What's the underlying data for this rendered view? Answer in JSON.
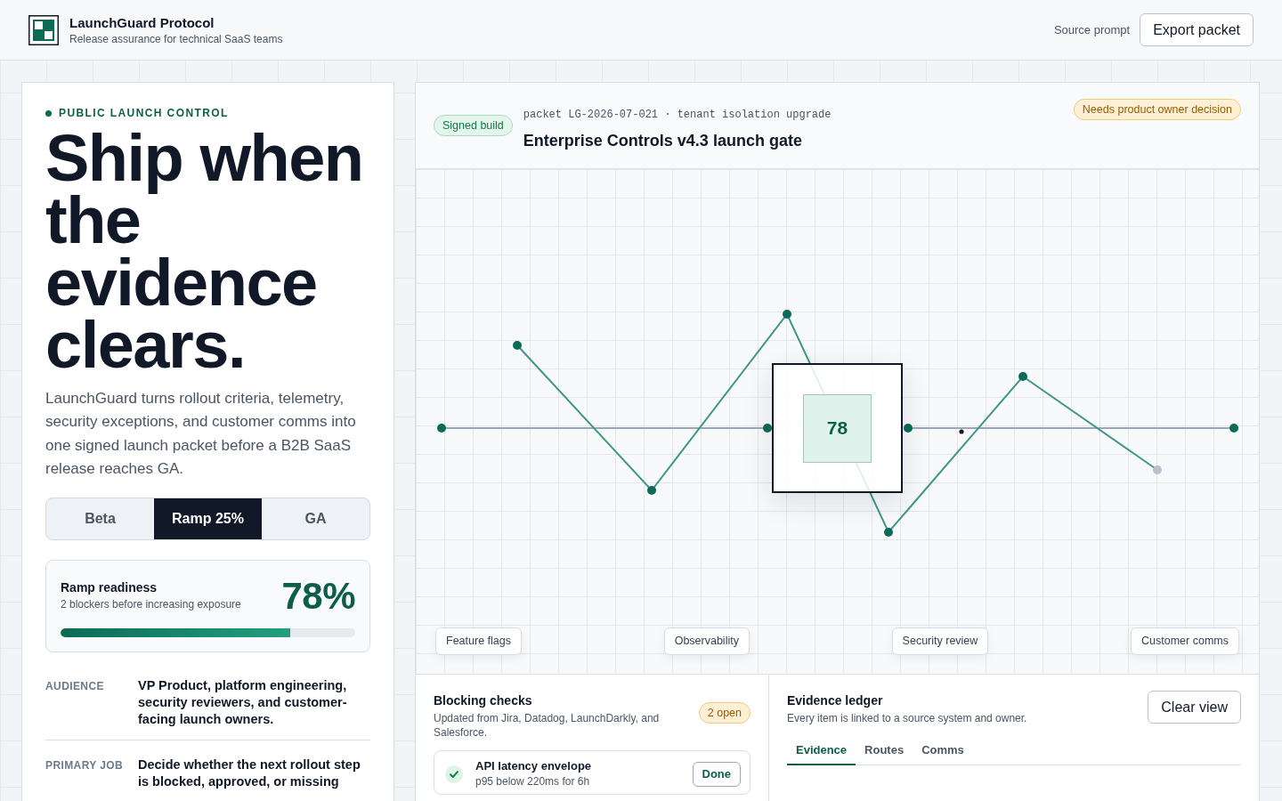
{
  "header": {
    "title": "LaunchGuard Protocol",
    "subtitle": "Release assurance for technical SaaS teams",
    "source_link": "Source prompt",
    "export_button": "Export packet"
  },
  "intro": {
    "kicker": "PUBLIC LAUNCH CONTROL",
    "headline": "Ship when the evidence clears.",
    "body": "LaunchGuard turns rollout criteria, telemetry, security exceptions, and customer comms into one signed launch packet before a B2B SaaS release reaches GA.",
    "stages": [
      {
        "label": "Beta",
        "selected": false
      },
      {
        "label": "Ramp 25%",
        "selected": true
      },
      {
        "label": "GA",
        "selected": false
      }
    ],
    "readiness": {
      "title": "Ramp readiness",
      "subtitle": "2 blockers before increasing exposure",
      "value": "78%",
      "level": 0.78
    },
    "facts": [
      {
        "term": "AUDIENCE",
        "detail": "VP Product, platform engineering, security reviewers, and customer-facing launch owners."
      },
      {
        "term": "PRIMARY JOB",
        "detail": "Decide whether the next rollout step is blocked, approved, or missing"
      }
    ]
  },
  "gate": {
    "badge": "Signed build",
    "packet": "packet LG-2026-07-021 · tenant isolation upgrade",
    "title": "Enterprise Controls v4.3 launch gate",
    "status": "Needs product owner decision",
    "chart": {
      "score": "78",
      "categories": [
        "Feature flags",
        "Observability",
        "Security review",
        "Customer comms"
      ]
    },
    "blocking_checks": {
      "title": "Blocking checks",
      "subtitle": "Updated from Jira, Datadog, LaunchDarkly, and Salesforce.",
      "count": "2 open",
      "items": [
        {
          "name": "API latency envelope",
          "detail": "p95 below 220ms for 6h",
          "passed": true,
          "action": "Done"
        }
      ]
    },
    "evidence_ledger": {
      "title": "Evidence ledger",
      "subtitle": "Every item is linked to a source system and owner.",
      "button": "Clear view",
      "tabs": [
        {
          "label": "Evidence",
          "selected": true
        },
        {
          "label": "Routes",
          "selected": false
        },
        {
          "label": "Comms",
          "selected": false
        }
      ]
    }
  }
}
